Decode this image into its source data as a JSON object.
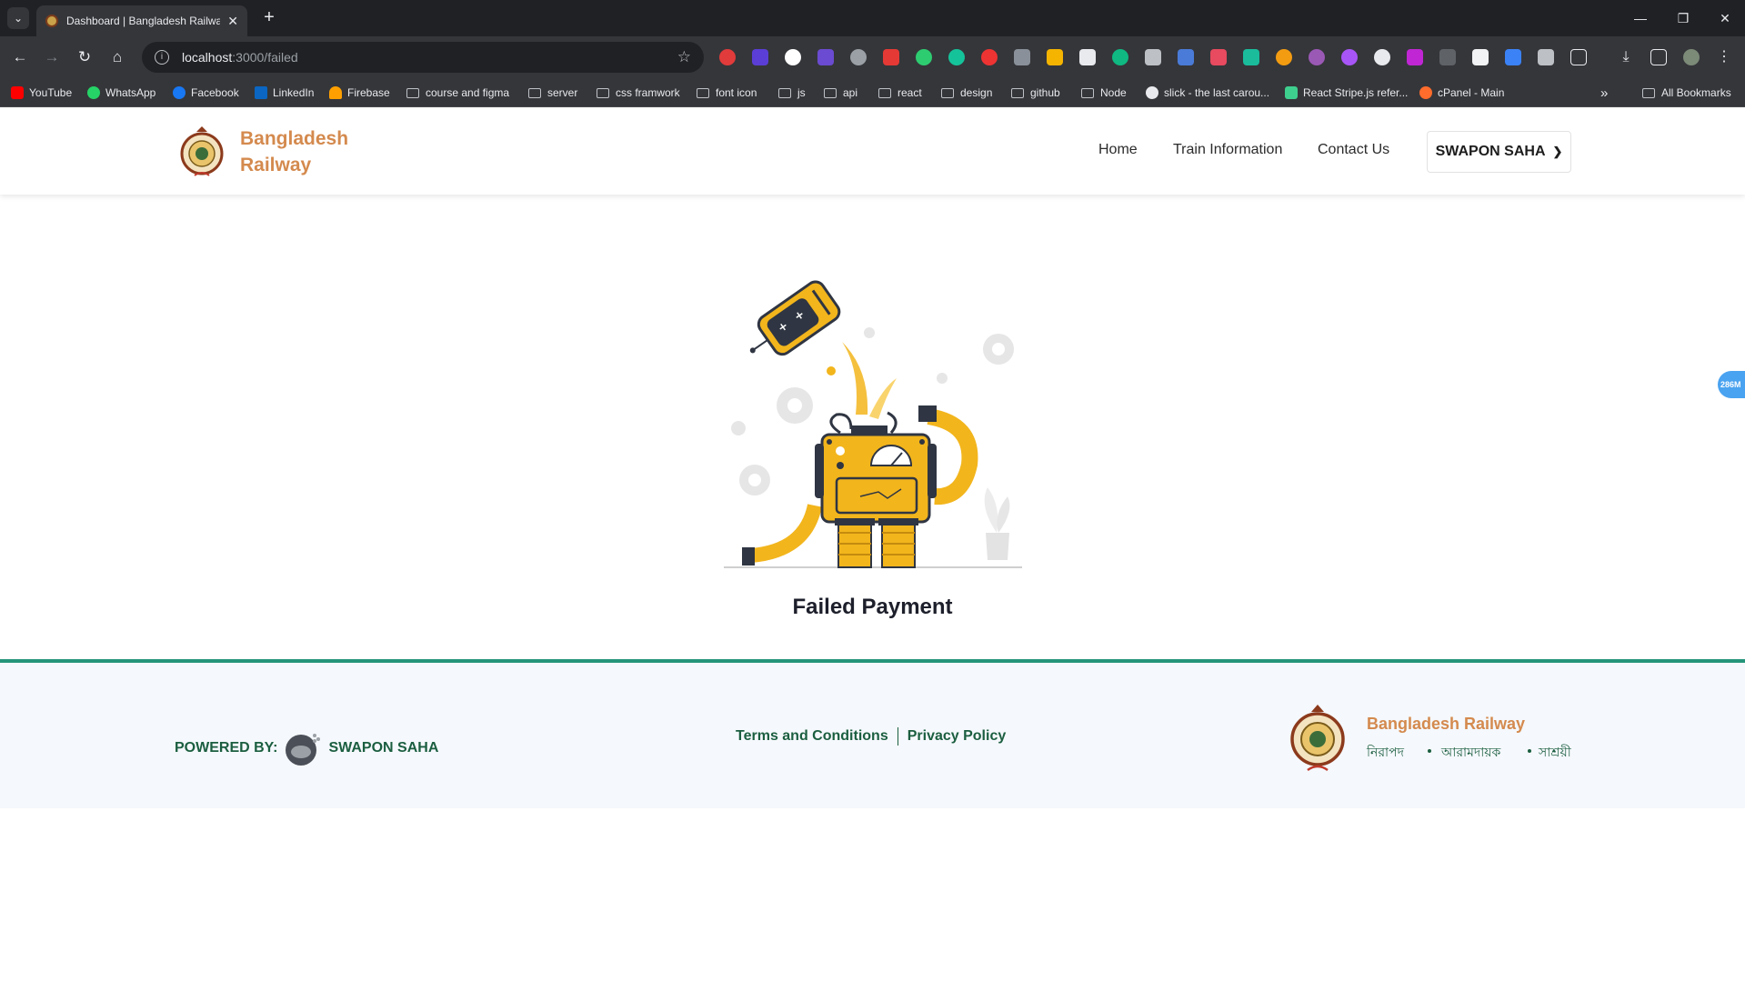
{
  "browser": {
    "tab_title": "Dashboard | Bangladesh Railwa",
    "url_host": "localhost",
    "url_path": ":3000/failed",
    "bookmarks": [
      "YouTube",
      "WhatsApp",
      "Facebook",
      "LinkedIn",
      "Firebase",
      "course and figma",
      "server",
      "css framwork",
      "font icon",
      "js",
      "api",
      "react",
      "design",
      "github",
      "Node",
      "slick - the last carou...",
      "React Stripe.js refer...",
      "cPanel - Main"
    ],
    "all_bookmarks": "All Bookmarks",
    "overflow": "»"
  },
  "header": {
    "brand_line1": "Bangladesh",
    "brand_line2": "Railway",
    "nav": [
      "Home",
      "Train Information",
      "Contact Us"
    ],
    "user_name": "SWAPON SAHA"
  },
  "floating_badge": "286M",
  "main": {
    "title": "Failed Payment"
  },
  "footer": {
    "powered_label": "POWERED BY:",
    "powered_name": "SWAPON SAHA",
    "terms": "Terms and Conditions",
    "privacy": "Privacy Policy",
    "brand": "Bangladesh Railway",
    "taglines": [
      "নিরাপদ",
      "আরামদায়ক",
      "সাশ্রয়ী"
    ]
  },
  "colors": {
    "brand_orange": "#d48a4e",
    "footer_green": "#1b5e40",
    "footer_border": "#25957a",
    "robot_yellow": "#f2b51c"
  }
}
